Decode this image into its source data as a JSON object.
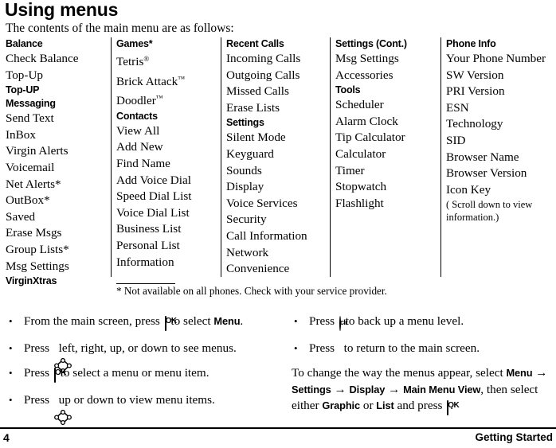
{
  "page": {
    "title": "Using menus",
    "intro": "The contents of the main menu are as follows:",
    "footnote": "* Not available on all phones. Check with your service provider."
  },
  "menu_columns": [
    {
      "id": "column-1",
      "entries": [
        {
          "type": "head",
          "label": "Balance"
        },
        {
          "type": "item",
          "label": "Check Balance"
        },
        {
          "type": "item",
          "label": "Top-Up"
        },
        {
          "type": "head",
          "label": "Top-UP"
        },
        {
          "type": "head",
          "label": "Messaging"
        },
        {
          "type": "item",
          "label": "Send Text"
        },
        {
          "type": "item",
          "label": "InBox"
        },
        {
          "type": "item",
          "label": "Virgin Alerts"
        },
        {
          "type": "item",
          "label": "Voicemail"
        },
        {
          "type": "item",
          "label": "Net Alerts*"
        },
        {
          "type": "item",
          "label": "OutBox*"
        },
        {
          "type": "item",
          "label": "Saved"
        },
        {
          "type": "item",
          "label": "Erase Msgs"
        },
        {
          "type": "item",
          "label": "Group Lists*"
        },
        {
          "type": "item",
          "label": "Msg Settings"
        },
        {
          "type": "head",
          "label": "VirginXtras"
        }
      ]
    },
    {
      "id": "column-2",
      "entries": [
        {
          "type": "head",
          "label": "Games*"
        },
        {
          "type": "item",
          "label": "Tetris",
          "sup": "®"
        },
        {
          "type": "item",
          "label": "Brick Attack",
          "sup": "™"
        },
        {
          "type": "item",
          "label": "Doodler",
          "sup": "™"
        },
        {
          "type": "head",
          "label": "Contacts"
        },
        {
          "type": "item",
          "label": "View All"
        },
        {
          "type": "item",
          "label": "Add New"
        },
        {
          "type": "item",
          "label": "Find Name"
        },
        {
          "type": "item",
          "label": "Add Voice Dial"
        },
        {
          "type": "item",
          "label": "Speed Dial List"
        },
        {
          "type": "item",
          "label": "Voice Dial List"
        },
        {
          "type": "item",
          "label": "Business List"
        },
        {
          "type": "item",
          "label": "Personal List"
        },
        {
          "type": "item",
          "label": "Information"
        }
      ]
    },
    {
      "id": "column-3",
      "entries": [
        {
          "type": "head",
          "label": "Recent Calls"
        },
        {
          "type": "item",
          "label": "Incoming Calls"
        },
        {
          "type": "item",
          "label": "Outgoing Calls"
        },
        {
          "type": "item",
          "label": "Missed Calls"
        },
        {
          "type": "item",
          "label": "Erase Lists"
        },
        {
          "type": "head",
          "label": "Settings"
        },
        {
          "type": "item",
          "label": "Silent Mode"
        },
        {
          "type": "item",
          "label": "Keyguard"
        },
        {
          "type": "item",
          "label": "Sounds"
        },
        {
          "type": "item",
          "label": "Display"
        },
        {
          "type": "item",
          "label": "Voice Services"
        },
        {
          "type": "item",
          "label": "Security"
        },
        {
          "type": "item",
          "label": "Call Information"
        },
        {
          "type": "item",
          "label": "Network"
        },
        {
          "type": "item",
          "label": "Convenience"
        }
      ]
    },
    {
      "id": "column-4",
      "entries": [
        {
          "type": "head",
          "label": "Settings (Cont.)"
        },
        {
          "type": "item",
          "label": "Msg Settings"
        },
        {
          "type": "item",
          "label": "Accessories"
        },
        {
          "type": "head",
          "label": "Tools"
        },
        {
          "type": "item",
          "label": "Scheduler"
        },
        {
          "type": "item",
          "label": "Alarm Clock"
        },
        {
          "type": "item",
          "label": "Tip Calculator"
        },
        {
          "type": "item",
          "label": "Calculator"
        },
        {
          "type": "item",
          "label": "Timer"
        },
        {
          "type": "item",
          "label": "Stopwatch"
        },
        {
          "type": "item",
          "label": "Flashlight"
        }
      ]
    },
    {
      "id": "column-5",
      "entries": [
        {
          "type": "head",
          "label": "Phone Info"
        },
        {
          "type": "item",
          "label": "Your Phone Number"
        },
        {
          "type": "item",
          "label": "SW Version"
        },
        {
          "type": "item",
          "label": "PRI Version"
        },
        {
          "type": "item",
          "label": "ESN"
        },
        {
          "type": "item",
          "label": "Technology"
        },
        {
          "type": "item",
          "label": "SID"
        },
        {
          "type": "item",
          "label": "Browser Name"
        },
        {
          "type": "item",
          "label": "Browser Version"
        },
        {
          "type": "item",
          "label": "Icon Key"
        },
        {
          "type": "note",
          "label": "( Scroll down to view"
        },
        {
          "type": "note",
          "label": "information.)"
        }
      ]
    }
  ],
  "instructions_left": [
    {
      "icon": "ok-key-icon",
      "before": "From the main screen, press ",
      "after": " to  select ",
      "bold_tail": "Menu",
      "end": "."
    },
    {
      "icon": "nav-key-icon",
      "before": "Press ",
      "after": " left, right, up, or down to see menus.",
      "bold_tail": "",
      "end": ""
    },
    {
      "icon": "ok-key-icon",
      "before": "Press ",
      "after": " to select a menu or menu item.",
      "bold_tail": "",
      "end": ""
    },
    {
      "icon": "nav-key-icon",
      "before": "Press ",
      "after": " up or down to view menu items.",
      "bold_tail": "",
      "end": ""
    }
  ],
  "instructions_right": [
    {
      "icon": "clr-key-icon",
      "before": "Press ",
      "after": " to back up a menu level."
    },
    {
      "icon": "end-key-icon",
      "before": "Press ",
      "after": " to return to the main screen."
    }
  ],
  "paragraph": {
    "p1": "To change the way the menus appear, select ",
    "b1": "Menu",
    "a1": " → ",
    "b2": "Settings",
    "a2": " → ",
    "b3": "Display",
    "a3": " → ",
    "b4": "Main Menu View",
    "a4": ", then select either ",
    "b5": "Graphic",
    "a5": " or ",
    "b6": "List",
    "a6": " and press ",
    "end": "."
  },
  "footer": {
    "page_number": "4",
    "section": "Getting Started"
  },
  "colors": {
    "text": "#000000",
    "background": "#ffffff",
    "rule": "#000000"
  }
}
